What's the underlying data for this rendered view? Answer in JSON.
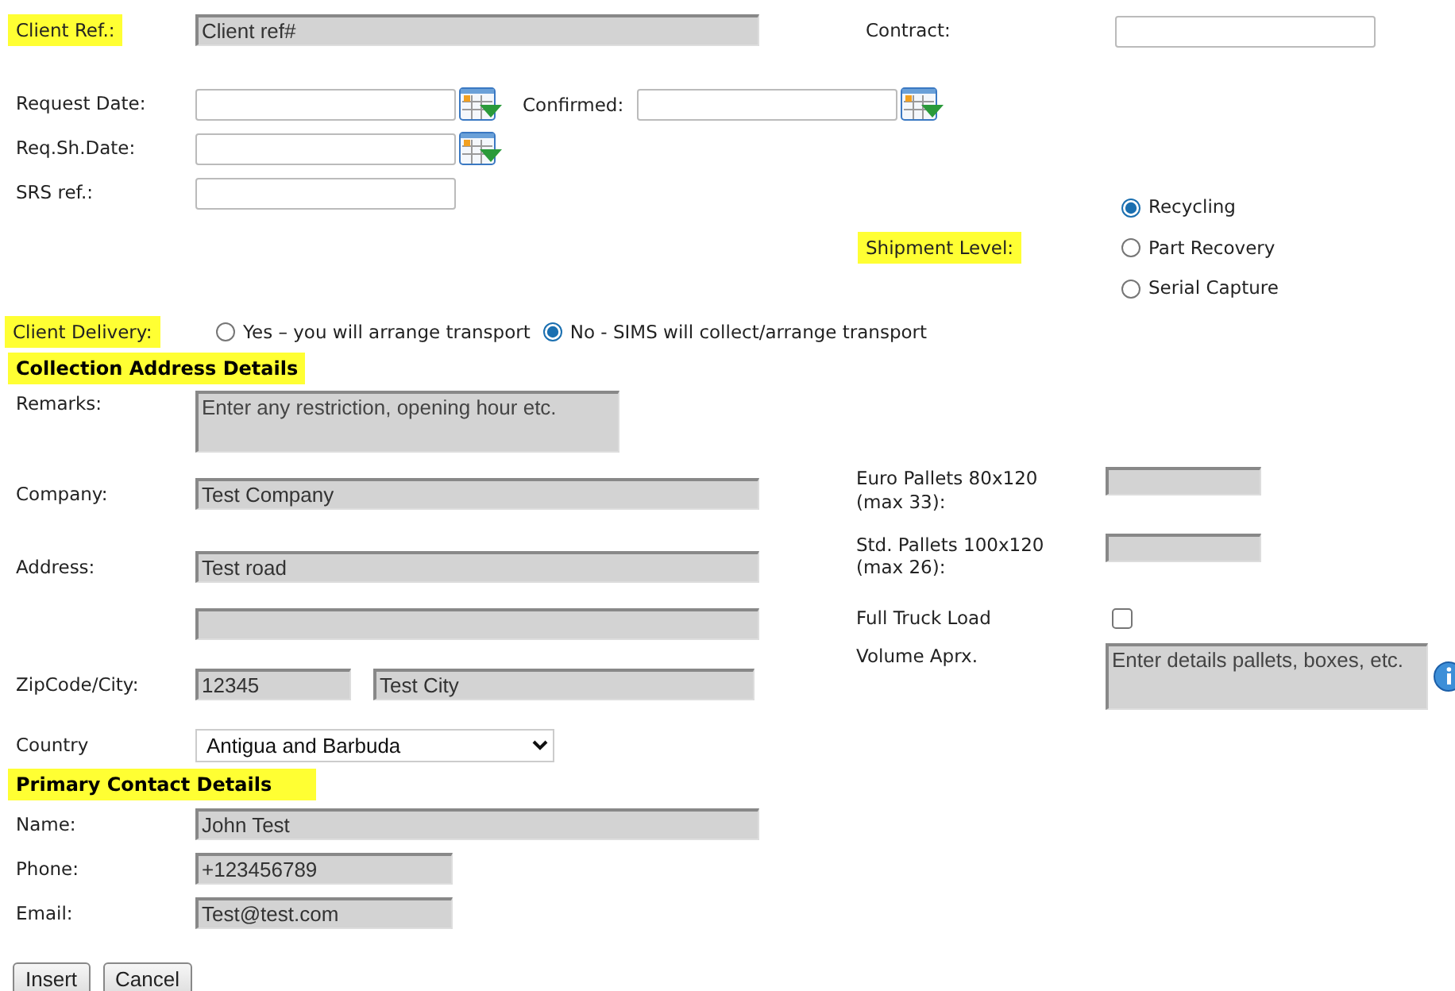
{
  "client_ref": {
    "label": "Client Ref.:",
    "highlighted": true,
    "value": "Client ref#",
    "disabled": true
  },
  "contract": {
    "label": "Contract:",
    "highlighted": false,
    "disabled": false
  },
  "request_date": {
    "label": "Request Date:",
    "highlighted": false,
    "disabled": false
  },
  "confirmed": {
    "label": "Confirmed:",
    "highlighted": false,
    "disabled": false
  },
  "req_sh_date": {
    "label": "Req.Sh.Date:",
    "highlighted": false,
    "disabled": false
  },
  "srs_ref": {
    "label": "SRS ref.:",
    "highlighted": false,
    "disabled": false
  },
  "shipment_level": {
    "label": "Shipment Level:",
    "highlighted": true,
    "options": [
      {
        "label": "Recycling",
        "selected": true
      },
      {
        "label": "Part Recovery",
        "selected": false
      },
      {
        "label": "Serial Capture",
        "selected": false
      }
    ]
  },
  "client_delivery": {
    "label": "Client Delivery:",
    "highlighted": true,
    "options": [
      {
        "label": "Yes – you will arrange transport",
        "selected": false
      },
      {
        "label": "No - SIMS will collect/arrange transport",
        "selected": true
      }
    ]
  },
  "collection_address": {
    "heading": "Collection Address Details",
    "remarks": {
      "label": "Remarks:",
      "highlighted": false,
      "placeholder": "Enter any restriction, opening hour etc.",
      "disabled": true
    },
    "company": {
      "label": "Company:",
      "highlighted": false,
      "value": "Test Company",
      "disabled": true
    },
    "address": {
      "label": "Address:",
      "highlighted": false,
      "value": "Test road",
      "disabled": true
    },
    "address_line_2": {
      "disabled": true
    },
    "zip_city": {
      "label": "ZipCode/City:",
      "highlighted": false,
      "zip": "12345",
      "city": "Test City",
      "disabled": true
    },
    "country": {
      "label": "Country",
      "highlighted": false,
      "value": "Antigua and Barbuda"
    },
    "euro_pallets": {
      "label": "Euro Pallets 80x120 (max 33):",
      "highlighted": false,
      "disabled": true
    },
    "std_pallets": {
      "label": "Std. Pallets 100x120 (max 26):",
      "highlighted": false,
      "disabled": true
    },
    "full_truck_load": {
      "label": "Full Truck Load",
      "highlighted": false,
      "checked": false
    },
    "volume": {
      "label": "Volume Aprx.",
      "highlighted": false,
      "placeholder": "Enter details pallets, boxes, etc.",
      "disabled": true
    }
  },
  "primary_contact": {
    "heading": "Primary Contact Details",
    "fields": [
      {
        "label": "Name:",
        "highlighted": false,
        "value": "John Test",
        "disabled": true
      },
      {
        "label": "Phone:",
        "highlighted": false,
        "value": "+123456789",
        "disabled": true
      },
      {
        "label": "Email:",
        "highlighted": false,
        "value": "Test@test.com",
        "disabled": true
      }
    ]
  },
  "buttons": [
    "Insert",
    "Cancel"
  ]
}
